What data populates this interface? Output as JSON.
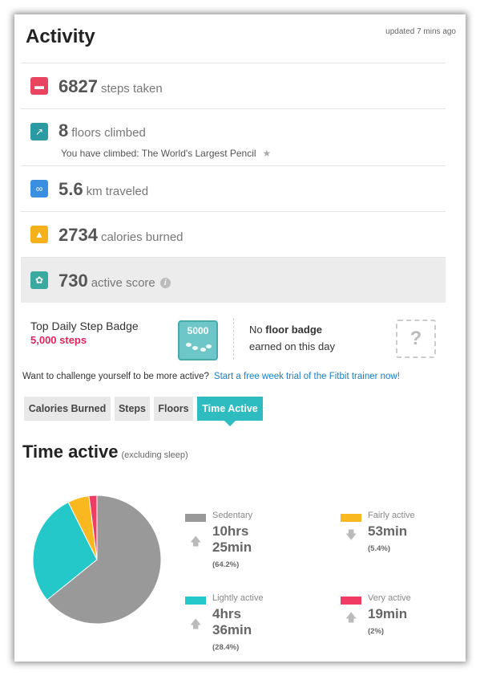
{
  "header": {
    "title": "Activity",
    "updated": "updated 7 mins ago"
  },
  "stats": [
    {
      "value": "6827",
      "label": "steps taken",
      "icon": "steps-icon",
      "color": "#e8435f"
    },
    {
      "value": "8",
      "label": "floors climbed",
      "icon": "stairs-icon",
      "color": "#2a9aa3",
      "sub": "You have climbed: The World's Largest Pencil"
    },
    {
      "value": "5.6",
      "label": "km traveled",
      "icon": "distance-icon",
      "color": "#3b8fe0"
    },
    {
      "value": "2734",
      "label": "calories burned",
      "icon": "flame-icon",
      "color": "#f5b11b"
    },
    {
      "value": "730",
      "label": "active score",
      "icon": "flower-icon",
      "color": "#3aa9a0"
    }
  ],
  "badges": {
    "step_title": "Top Daily Step Badge",
    "step_value": "5,000 steps",
    "step_badge_text": "5000",
    "floor_no": "No",
    "floor_badge": "floor badge",
    "floor_earned": "earned on this day",
    "floor_placeholder": "?"
  },
  "challenge": {
    "text": "Want to challenge yourself to be more active?",
    "link": "Start a free week trial of the Fitbit trainer now!"
  },
  "tabs": [
    "Calories Burned",
    "Steps",
    "Floors",
    "Time Active"
  ],
  "active_tab": "Time Active",
  "section": {
    "title": "Time active",
    "note": "(excluding sleep)"
  },
  "legend": [
    {
      "name": "Sedentary",
      "line1": "10hrs",
      "line2": "25min",
      "pct": "(64.2%)",
      "color": "#999999",
      "trend": "up"
    },
    {
      "name": "Fairly active",
      "line1": "53min",
      "line2": "",
      "pct": "(5.4%)",
      "color": "#f9b81f",
      "trend": "down"
    },
    {
      "name": "Lightly active",
      "line1": "4hrs",
      "line2": "36min",
      "pct": "(28.4%)",
      "color": "#24c8c8",
      "trend": "up"
    },
    {
      "name": "Very active",
      "line1": "19min",
      "line2": "",
      "pct": "(2%)",
      "color": "#f03c64",
      "trend": "up"
    }
  ],
  "chart_data": {
    "type": "pie",
    "categories": [
      "Sedentary",
      "Lightly active",
      "Fairly active",
      "Very active"
    ],
    "values": [
      64.2,
      28.4,
      5.4,
      2.0
    ],
    "colors": [
      "#999999",
      "#24c8c8",
      "#f9b81f",
      "#f03c64"
    ]
  }
}
